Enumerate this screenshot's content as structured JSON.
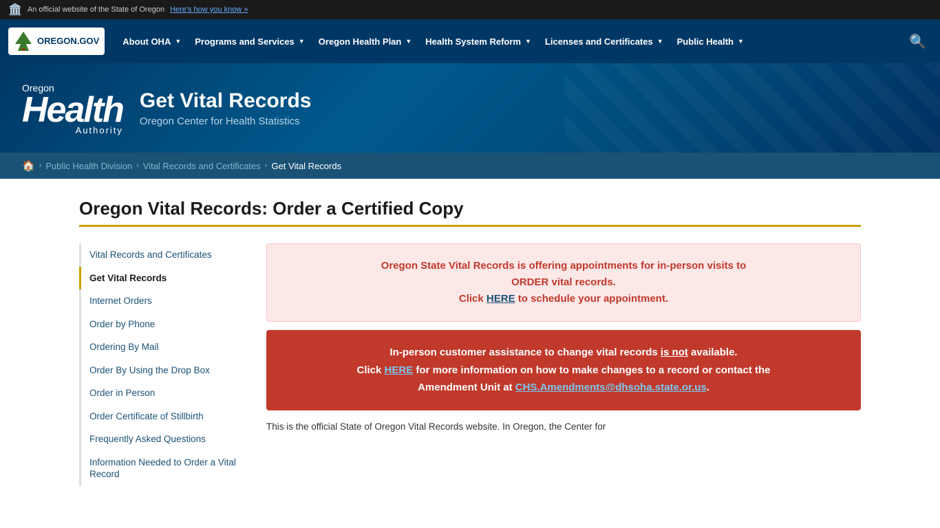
{
  "topbar": {
    "text": "An official website of the State of Oregon",
    "link_text": "Here's how you know »"
  },
  "nav": {
    "logo_text": "OREGON.GOV",
    "items": [
      {
        "label": "About OHA",
        "id": "about-oha"
      },
      {
        "label": "Programs and Services",
        "id": "programs-services"
      },
      {
        "label": "Oregon Health Plan",
        "id": "oregon-health-plan"
      },
      {
        "label": "Health System Reform",
        "id": "health-system-reform"
      },
      {
        "label": "Licenses and Certificates",
        "id": "licenses-certs"
      },
      {
        "label": "Public Health",
        "id": "public-health"
      }
    ]
  },
  "hero": {
    "logo_small": "Oregon",
    "logo_big": "Health",
    "logo_authority": "Authority",
    "title": "Get Vital Records",
    "subtitle": "Oregon Center for Health Statistics"
  },
  "breadcrumb": {
    "home_label": "🏠",
    "items": [
      {
        "label": "Public Health Division",
        "href": "#"
      },
      {
        "label": "Vital Records and Certificates",
        "href": "#"
      },
      {
        "label": "Get Vital Records",
        "current": true
      }
    ]
  },
  "page": {
    "title": "Oregon Vital Records: Order a Certified Copy"
  },
  "sidebar": {
    "items": [
      {
        "label": "Vital Records and Certificates",
        "active": false,
        "id": "sidebar-vital-records"
      },
      {
        "label": "Get Vital Records",
        "active": true,
        "id": "sidebar-get-vital-records"
      },
      {
        "label": "Internet Orders",
        "active": false,
        "id": "sidebar-internet-orders"
      },
      {
        "label": "Order by Phone",
        "active": false,
        "id": "sidebar-order-phone"
      },
      {
        "label": "Ordering By Mail",
        "active": false,
        "id": "sidebar-ordering-mail"
      },
      {
        "label": "Order By Using the Drop Box",
        "active": false,
        "id": "sidebar-drop-box"
      },
      {
        "label": "Order in Person",
        "active": false,
        "id": "sidebar-order-person"
      },
      {
        "label": "Order Certificate of Stillbirth",
        "active": false,
        "id": "sidebar-stillbirth"
      },
      {
        "label": "Frequently Asked Questions",
        "active": false,
        "id": "sidebar-faq"
      },
      {
        "label": "Information Needed to Order a Vital Record",
        "active": false,
        "id": "sidebar-info-needed"
      }
    ]
  },
  "notices": {
    "pink": {
      "line1": "Oregon State Vital Records is offering appointments for in-person visits to",
      "line2": "ORDER vital records.",
      "line3_pre": "Click ",
      "line3_link": "HERE",
      "line3_post": " to schedule your appointment."
    },
    "red": {
      "line1_pre": "In-person customer assistance to change vital records ",
      "line1_underline": "is not",
      "line1_post": " available.",
      "line2_pre": "Click ",
      "line2_link": "HERE",
      "line2_post": " for more information on how to make changes to a record or contact the",
      "line3_pre": "Amendment Unit at ",
      "line3_email": "CHS.Amendments@dhsoha.state.or.us",
      "line3_post": "."
    }
  },
  "bottom_text": "This is the official State of Oregon Vital Records website. In Oregon, the Center for"
}
